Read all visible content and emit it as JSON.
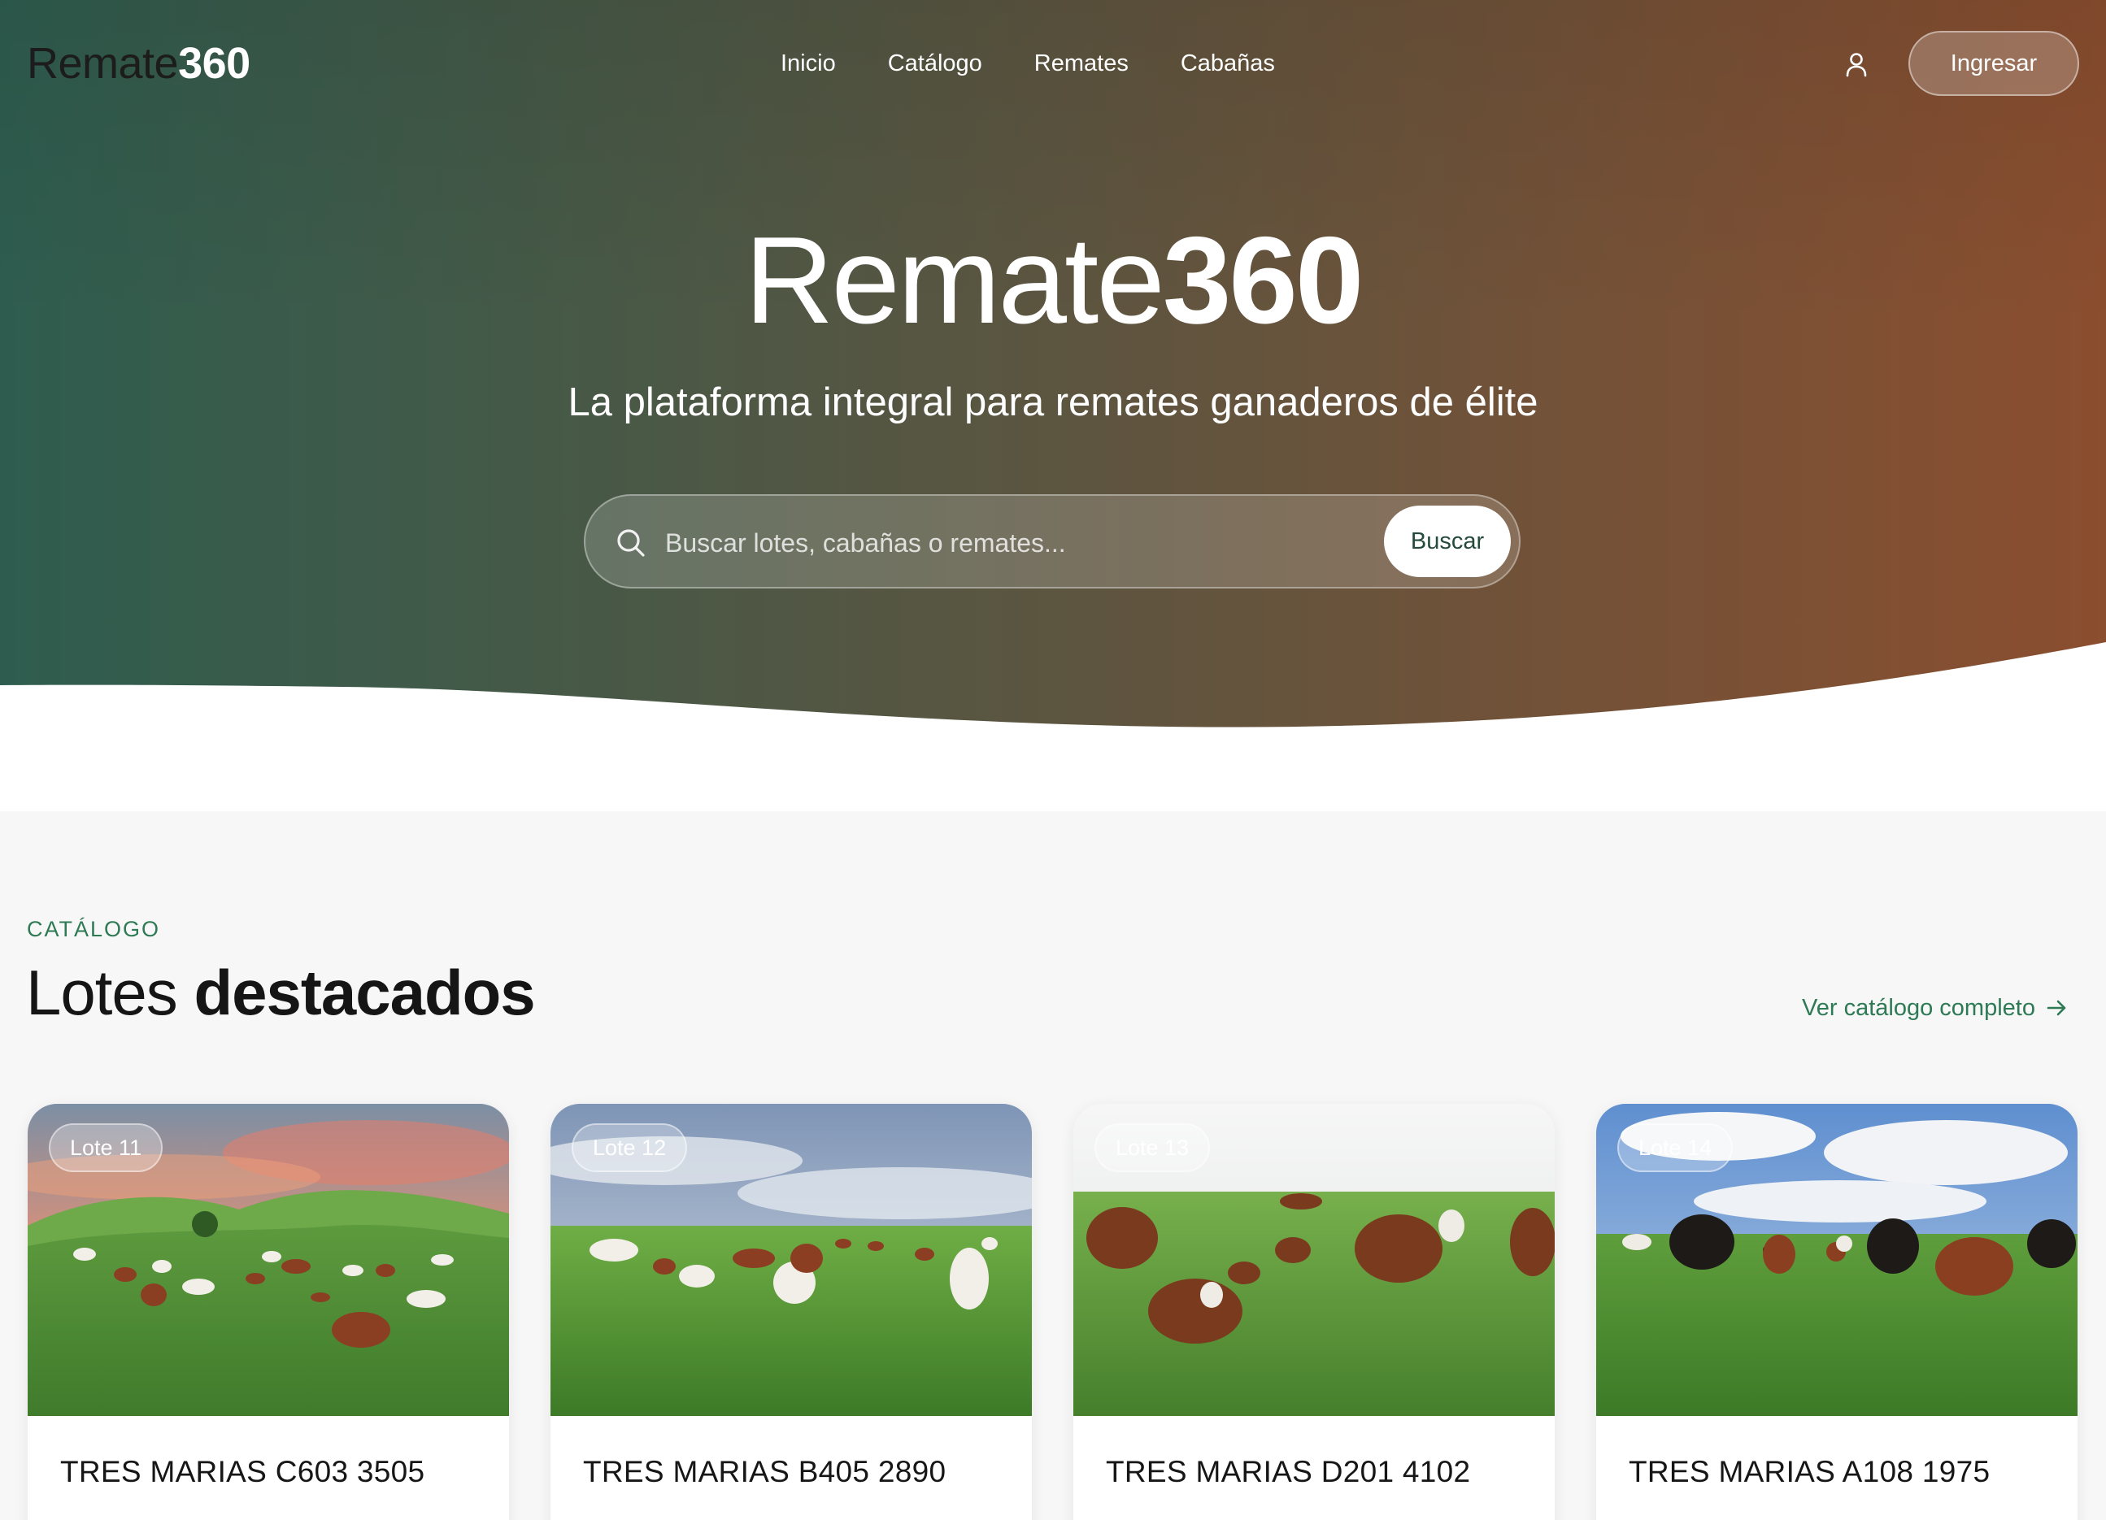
{
  "brand": {
    "name_light": "Remate",
    "name_bold": "360"
  },
  "nav": {
    "items": [
      {
        "label": "Inicio"
      },
      {
        "label": "Catálogo"
      },
      {
        "label": "Remates"
      },
      {
        "label": "Cabañas"
      }
    ],
    "login_label": "Ingresar",
    "user_icon": "user-icon"
  },
  "hero": {
    "title_light": "Remate",
    "title_bold": "360",
    "subtitle": "La plataforma integral para remates ganaderos de élite",
    "gradient": [
      "#2f5e4f",
      "#5a5540",
      "#8a4f30"
    ]
  },
  "search": {
    "placeholder": "Buscar lotes, cabañas o remates...",
    "value": "",
    "button_label": "Buscar",
    "icon": "search-icon"
  },
  "featured": {
    "eyebrow": "CATÁLOGO",
    "title_light": "Lotes",
    "title_bold": "destacados",
    "see_all_label": "Ver catálogo completo",
    "see_all_icon": "arrow-right-icon",
    "accent": "#2e7a55",
    "lots": [
      {
        "badge": "Lote 11",
        "name": "TRES MARIAS C603 3505",
        "scene": "sunset"
      },
      {
        "badge": "Lote 12",
        "name": "TRES MARIAS B405 2890",
        "scene": "cloudy"
      },
      {
        "badge": "Lote 13",
        "name": "TRES MARIAS D201 4102",
        "scene": "haze"
      },
      {
        "badge": "Lote 14",
        "name": "TRES MARIAS A108 1975",
        "scene": "sunny"
      }
    ]
  }
}
